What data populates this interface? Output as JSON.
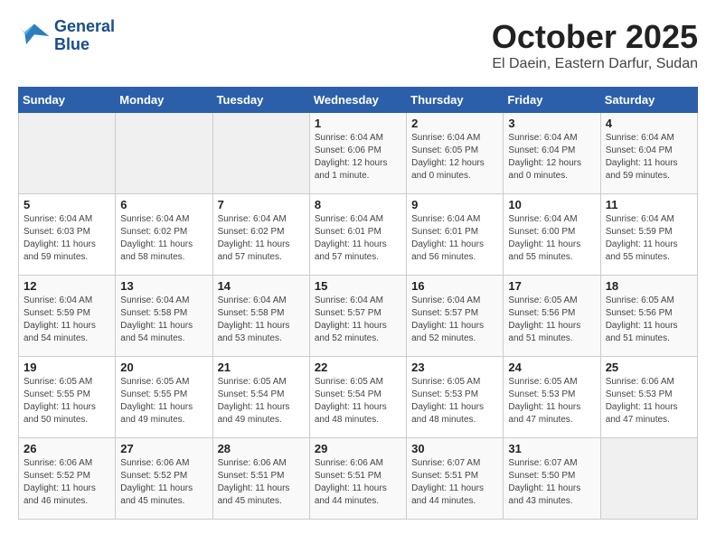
{
  "header": {
    "logo_line1": "General",
    "logo_line2": "Blue",
    "month": "October 2025",
    "location": "El Daein, Eastern Darfur, Sudan"
  },
  "weekdays": [
    "Sunday",
    "Monday",
    "Tuesday",
    "Wednesday",
    "Thursday",
    "Friday",
    "Saturday"
  ],
  "weeks": [
    [
      {
        "day": "",
        "info": ""
      },
      {
        "day": "",
        "info": ""
      },
      {
        "day": "",
        "info": ""
      },
      {
        "day": "1",
        "info": "Sunrise: 6:04 AM\nSunset: 6:06 PM\nDaylight: 12 hours\nand 1 minute."
      },
      {
        "day": "2",
        "info": "Sunrise: 6:04 AM\nSunset: 6:05 PM\nDaylight: 12 hours\nand 0 minutes."
      },
      {
        "day": "3",
        "info": "Sunrise: 6:04 AM\nSunset: 6:04 PM\nDaylight: 12 hours\nand 0 minutes."
      },
      {
        "day": "4",
        "info": "Sunrise: 6:04 AM\nSunset: 6:04 PM\nDaylight: 11 hours\nand 59 minutes."
      }
    ],
    [
      {
        "day": "5",
        "info": "Sunrise: 6:04 AM\nSunset: 6:03 PM\nDaylight: 11 hours\nand 59 minutes."
      },
      {
        "day": "6",
        "info": "Sunrise: 6:04 AM\nSunset: 6:02 PM\nDaylight: 11 hours\nand 58 minutes."
      },
      {
        "day": "7",
        "info": "Sunrise: 6:04 AM\nSunset: 6:02 PM\nDaylight: 11 hours\nand 57 minutes."
      },
      {
        "day": "8",
        "info": "Sunrise: 6:04 AM\nSunset: 6:01 PM\nDaylight: 11 hours\nand 57 minutes."
      },
      {
        "day": "9",
        "info": "Sunrise: 6:04 AM\nSunset: 6:01 PM\nDaylight: 11 hours\nand 56 minutes."
      },
      {
        "day": "10",
        "info": "Sunrise: 6:04 AM\nSunset: 6:00 PM\nDaylight: 11 hours\nand 55 minutes."
      },
      {
        "day": "11",
        "info": "Sunrise: 6:04 AM\nSunset: 5:59 PM\nDaylight: 11 hours\nand 55 minutes."
      }
    ],
    [
      {
        "day": "12",
        "info": "Sunrise: 6:04 AM\nSunset: 5:59 PM\nDaylight: 11 hours\nand 54 minutes."
      },
      {
        "day": "13",
        "info": "Sunrise: 6:04 AM\nSunset: 5:58 PM\nDaylight: 11 hours\nand 54 minutes."
      },
      {
        "day": "14",
        "info": "Sunrise: 6:04 AM\nSunset: 5:58 PM\nDaylight: 11 hours\nand 53 minutes."
      },
      {
        "day": "15",
        "info": "Sunrise: 6:04 AM\nSunset: 5:57 PM\nDaylight: 11 hours\nand 52 minutes."
      },
      {
        "day": "16",
        "info": "Sunrise: 6:04 AM\nSunset: 5:57 PM\nDaylight: 11 hours\nand 52 minutes."
      },
      {
        "day": "17",
        "info": "Sunrise: 6:05 AM\nSunset: 5:56 PM\nDaylight: 11 hours\nand 51 minutes."
      },
      {
        "day": "18",
        "info": "Sunrise: 6:05 AM\nSunset: 5:56 PM\nDaylight: 11 hours\nand 51 minutes."
      }
    ],
    [
      {
        "day": "19",
        "info": "Sunrise: 6:05 AM\nSunset: 5:55 PM\nDaylight: 11 hours\nand 50 minutes."
      },
      {
        "day": "20",
        "info": "Sunrise: 6:05 AM\nSunset: 5:55 PM\nDaylight: 11 hours\nand 49 minutes."
      },
      {
        "day": "21",
        "info": "Sunrise: 6:05 AM\nSunset: 5:54 PM\nDaylight: 11 hours\nand 49 minutes."
      },
      {
        "day": "22",
        "info": "Sunrise: 6:05 AM\nSunset: 5:54 PM\nDaylight: 11 hours\nand 48 minutes."
      },
      {
        "day": "23",
        "info": "Sunrise: 6:05 AM\nSunset: 5:53 PM\nDaylight: 11 hours\nand 48 minutes."
      },
      {
        "day": "24",
        "info": "Sunrise: 6:05 AM\nSunset: 5:53 PM\nDaylight: 11 hours\nand 47 minutes."
      },
      {
        "day": "25",
        "info": "Sunrise: 6:06 AM\nSunset: 5:53 PM\nDaylight: 11 hours\nand 47 minutes."
      }
    ],
    [
      {
        "day": "26",
        "info": "Sunrise: 6:06 AM\nSunset: 5:52 PM\nDaylight: 11 hours\nand 46 minutes."
      },
      {
        "day": "27",
        "info": "Sunrise: 6:06 AM\nSunset: 5:52 PM\nDaylight: 11 hours\nand 45 minutes."
      },
      {
        "day": "28",
        "info": "Sunrise: 6:06 AM\nSunset: 5:51 PM\nDaylight: 11 hours\nand 45 minutes."
      },
      {
        "day": "29",
        "info": "Sunrise: 6:06 AM\nSunset: 5:51 PM\nDaylight: 11 hours\nand 44 minutes."
      },
      {
        "day": "30",
        "info": "Sunrise: 6:07 AM\nSunset: 5:51 PM\nDaylight: 11 hours\nand 44 minutes."
      },
      {
        "day": "31",
        "info": "Sunrise: 6:07 AM\nSunset: 5:50 PM\nDaylight: 11 hours\nand 43 minutes."
      },
      {
        "day": "",
        "info": ""
      }
    ]
  ]
}
